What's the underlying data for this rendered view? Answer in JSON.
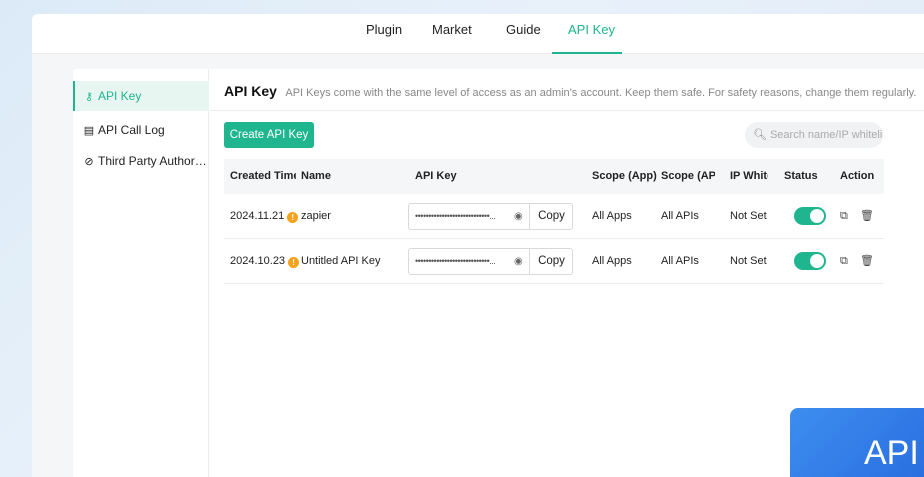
{
  "nav": {
    "tabs": [
      {
        "label": "Plugin"
      },
      {
        "label": "Market"
      },
      {
        "label": "Guide"
      },
      {
        "label": "API Key"
      }
    ],
    "active_tab": "API Key"
  },
  "sidebar": {
    "items": [
      {
        "label": "API Key",
        "icon": "key-icon"
      },
      {
        "label": "API Call Log",
        "icon": "log-icon"
      },
      {
        "label": "Third Party Authorization",
        "icon": "shield-check-icon"
      }
    ]
  },
  "header": {
    "title": "API Key",
    "description": "API Keys come with the same level of access as an admin's account. Keep them safe. For safety reasons, change them regularly."
  },
  "toolbar": {
    "create_label": "Create API Key",
    "search_placeholder": "Search name/IP whitelist"
  },
  "table": {
    "columns": [
      "Created Time",
      "Name",
      "API Key",
      "Scope (App)",
      "Scope (API)",
      "IP Whitelist",
      "Status",
      "Action"
    ],
    "rows": [
      {
        "created": "2024.11.21",
        "name": "zapier",
        "key_mask": "••••••••••••••••••••••••••••...",
        "copy_label": "Copy",
        "scope_app": "All Apps",
        "scope_api": "All APIs",
        "ip_whitelist": "Not Set",
        "status_on": true
      },
      {
        "created": "2024.10.23",
        "name": "Untitled API Key",
        "key_mask": "••••••••••••••••••••••••••••...",
        "copy_label": "Copy",
        "scope_app": "All Apps",
        "scope_api": "All APIs",
        "ip_whitelist": "Not Set",
        "status_on": true
      }
    ]
  },
  "badge": {
    "text": "API"
  },
  "colors": {
    "accent": "#1fb58f",
    "warning": "#f7a21b",
    "badge": "#3d8ef0"
  }
}
